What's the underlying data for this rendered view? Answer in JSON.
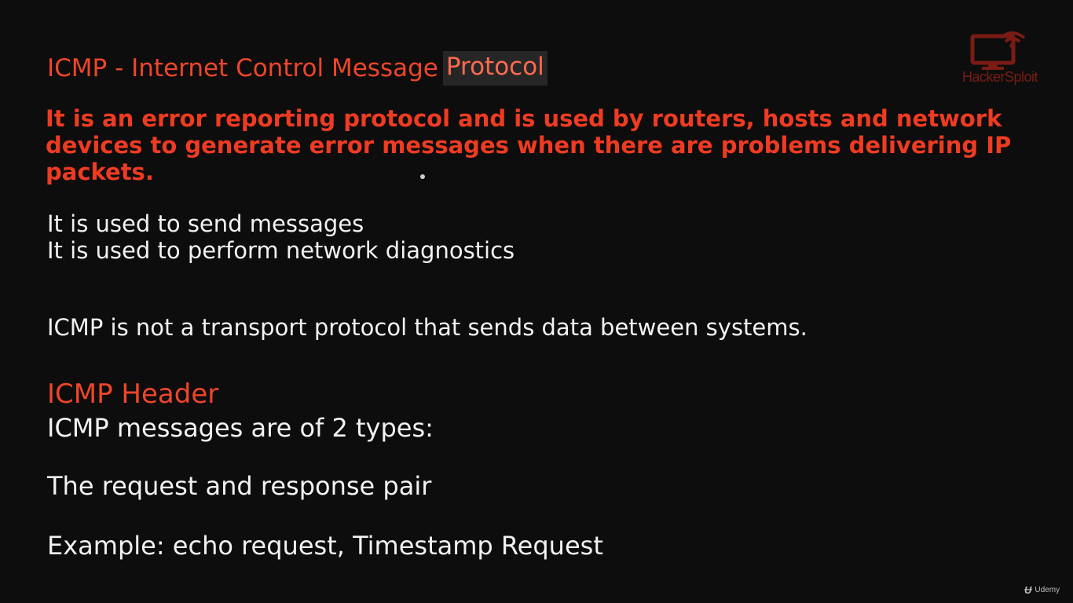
{
  "slide": {
    "title_main": "ICMP - Internet Control Message",
    "title_highlight": "Protocol",
    "intro": "It is an error reporting protocol and is used by routers, hosts and network devices to generate error messages when there are problems delivering IP packets.",
    "line_send": "It is used to send messages",
    "line_diagnostics": "It is used to perform network diagnostics",
    "line_not_transport": "ICMP is not a transport protocol that sends data between systems.",
    "section_heading": "ICMP Header",
    "line_types": "ICMP messages are of 2 types:",
    "line_pair": "The request and response pair",
    "line_example": "Example: echo request, Timestamp Request"
  },
  "watermark": {
    "logo_text": "HackerSploit",
    "logo_icon": "monitor-wifi-icon",
    "platform_text": "Udemy",
    "platform_icon": "udemy-logo-icon"
  },
  "colors": {
    "background": "#0d0d0d",
    "accent_red": "#f0452a",
    "body_text": "#f2f2f2",
    "logo_red": "#7a1c14"
  }
}
